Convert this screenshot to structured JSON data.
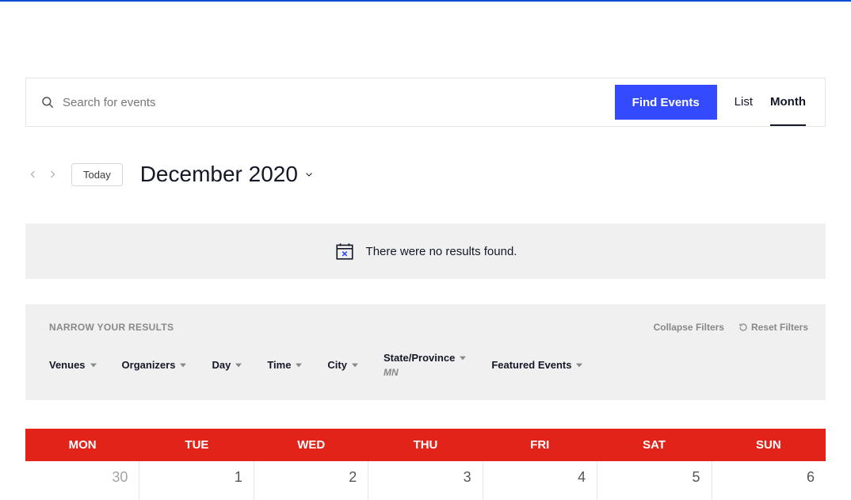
{
  "search": {
    "placeholder": "Search for events",
    "find_label": "Find Events"
  },
  "views": {
    "list": "List",
    "month": "Month"
  },
  "nav": {
    "today": "Today",
    "month_title": "December 2020"
  },
  "noresults": {
    "text": "There were no results found."
  },
  "filters": {
    "narrow_label": "NARROW YOUR RESULTS",
    "collapse": "Collapse Filters",
    "reset": "Reset Filters",
    "items": {
      "venues": "Venues",
      "organizers": "Organizers",
      "day": "Day",
      "time": "Time",
      "city": "City",
      "state": "State/Province",
      "state_value": "MN",
      "featured": "Featured Events"
    }
  },
  "calendar": {
    "headers": [
      "MON",
      "TUE",
      "WED",
      "THU",
      "FRI",
      "SAT",
      "SUN"
    ],
    "row1": [
      "30",
      "1",
      "2",
      "3",
      "4",
      "5",
      "6"
    ]
  }
}
